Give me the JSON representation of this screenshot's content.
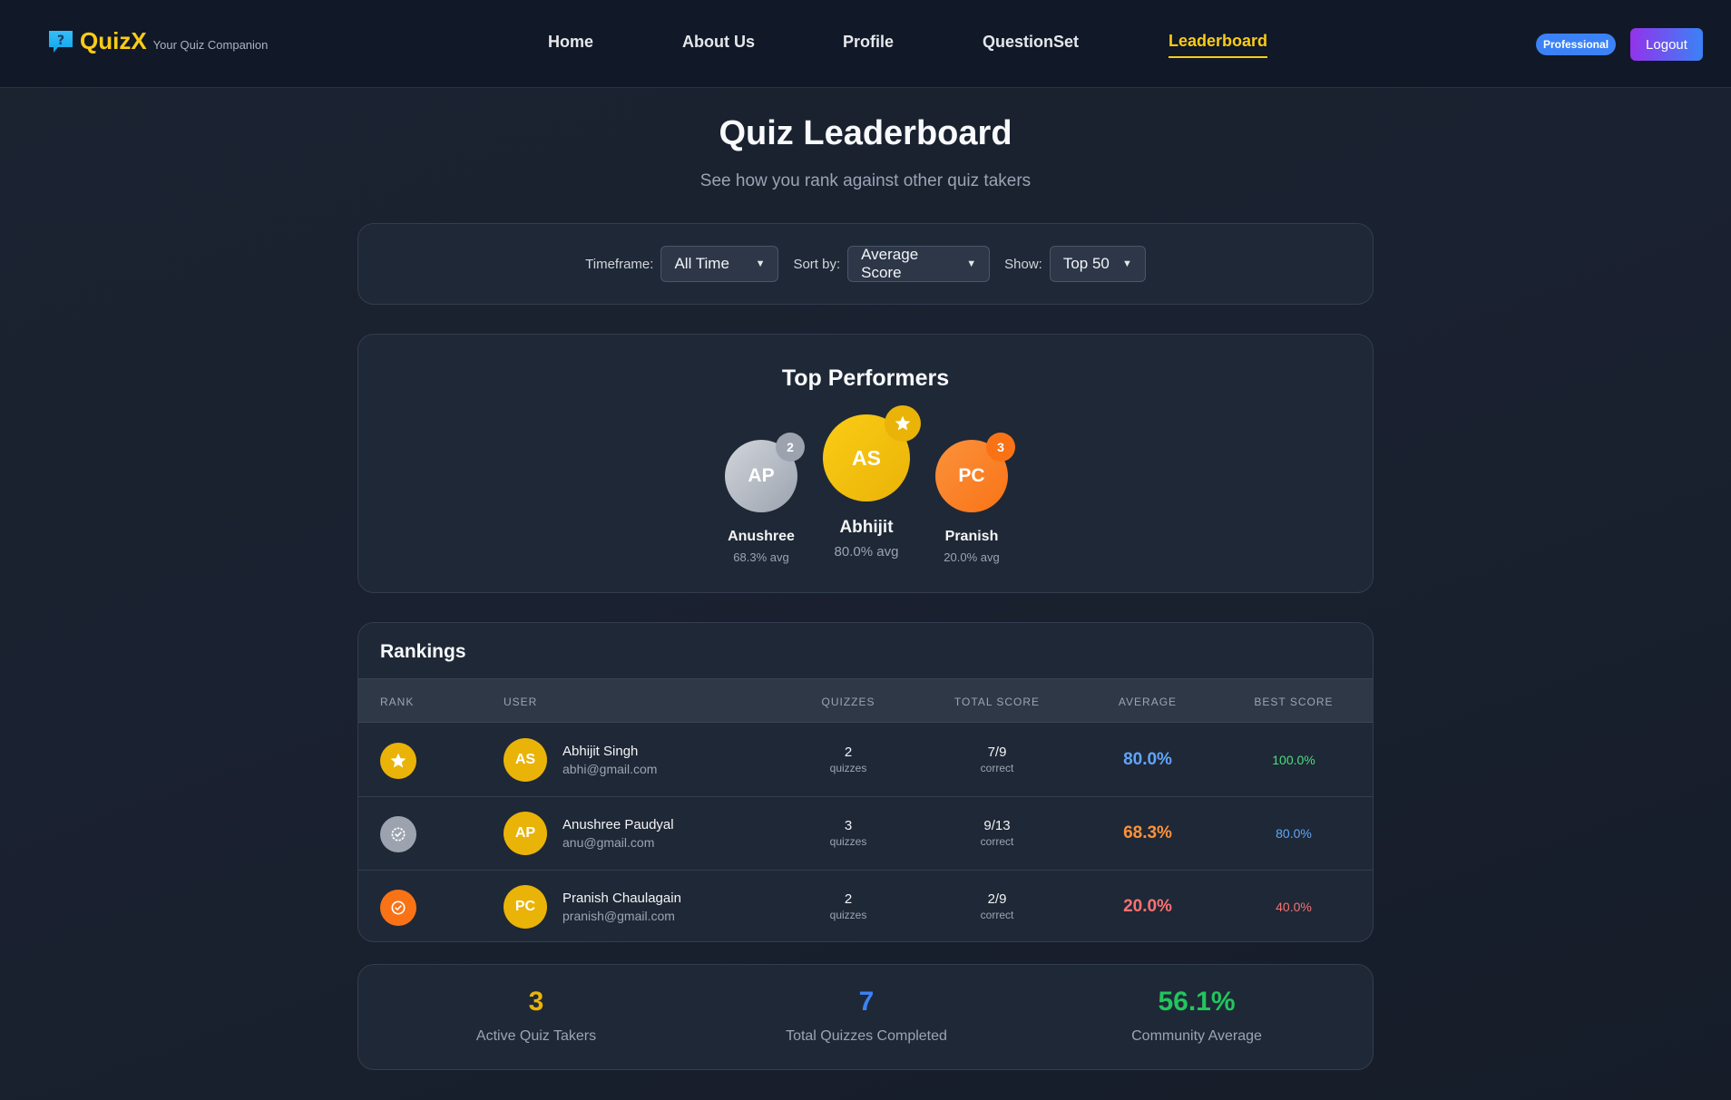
{
  "brand": {
    "name": "QuizX",
    "tagline": "Your Quiz Companion"
  },
  "nav": {
    "links": [
      "Home",
      "About Us",
      "Profile",
      "QuestionSet",
      "Leaderboard"
    ],
    "active": "Leaderboard"
  },
  "account": {
    "plan_badge": "Professional",
    "logout_label": "Logout"
  },
  "header": {
    "title": "Quiz Leaderboard",
    "subtitle": "See how you rank against other quiz takers"
  },
  "filters": {
    "timeframe_label": "Timeframe:",
    "timeframe_value": "All Time",
    "sort_label": "Sort by:",
    "sort_value": "Average Score",
    "show_label": "Show:",
    "show_value": "Top 50"
  },
  "podium": {
    "title": "Top Performers",
    "first": {
      "initials": "AS",
      "name": "Abhijit",
      "avg": "80.0% avg"
    },
    "second": {
      "initials": "AP",
      "name": "Anushree",
      "avg": "68.3% avg",
      "badge": "2"
    },
    "third": {
      "initials": "PC",
      "name": "Pranish",
      "avg": "20.0% avg",
      "badge": "3"
    }
  },
  "rankings": {
    "title": "Rankings",
    "columns": [
      "RANK",
      "USER",
      "QUIZZES",
      "TOTAL SCORE",
      "AVERAGE",
      "BEST SCORE"
    ],
    "rows": [
      {
        "initials": "AS",
        "name": "Abhijit Singh",
        "email": "abhi@gmail.com",
        "quizzes": "2",
        "quizzes_unit": "quizzes",
        "total": "7/9",
        "total_unit": "correct",
        "average": "80.0%",
        "best": "100.0%"
      },
      {
        "initials": "AP",
        "name": "Anushree Paudyal",
        "email": "anu@gmail.com",
        "quizzes": "3",
        "quizzes_unit": "quizzes",
        "total": "9/13",
        "total_unit": "correct",
        "average": "68.3%",
        "best": "80.0%"
      },
      {
        "initials": "PC",
        "name": "Pranish Chaulagain",
        "email": "pranish@gmail.com",
        "quizzes": "2",
        "quizzes_unit": "quizzes",
        "total": "2/9",
        "total_unit": "correct",
        "average": "20.0%",
        "best": "40.0%"
      }
    ]
  },
  "stats": [
    {
      "value": "3",
      "label": "Active Quiz Takers"
    },
    {
      "value": "7",
      "label": "Total Quizzes Completed"
    },
    {
      "value": "56.1%",
      "label": "Community Average"
    }
  ],
  "colors": {
    "gold": "#facc15",
    "silver": "#9ca3af",
    "bronze": "#f97316",
    "blue": "#60a5fa",
    "orange": "#fb923c",
    "red": "#f87171",
    "green": "#4ade80"
  }
}
